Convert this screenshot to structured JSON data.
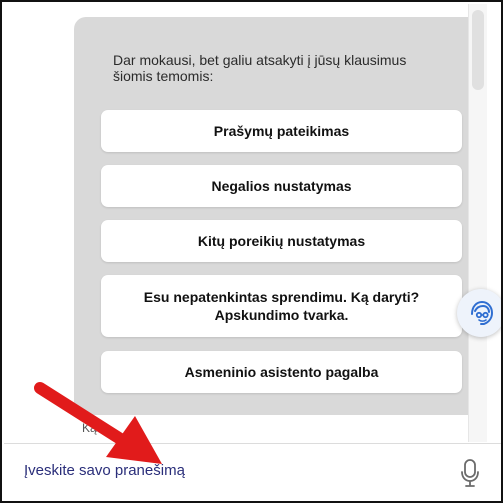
{
  "bubble": {
    "text": "Dar mokausi, bet galiu atsakyti į jūsų klausimus šiomis temomis:"
  },
  "options": [
    "Prašymų pateikimas",
    "Negalios nustatymas",
    "Kitų poreikių nustatymas",
    "Esu nepatenkintas sprendimu. Ką daryti? Apskundimo tvarka.",
    "Asmeninio asistento pagalba"
  ],
  "truncated_message": "Ką",
  "input": {
    "placeholder": "Įveskite savo pranešimą"
  },
  "icons": {
    "assistant": "assistant-head-icon",
    "microphone": "microphone-icon",
    "annotation": "red-arrow-icon"
  },
  "colors": {
    "bubble": "#d9d9d9",
    "input_text": "#2a2e7a",
    "assistant_icon": "#2f6ed1",
    "arrow": "#e11b1b"
  }
}
